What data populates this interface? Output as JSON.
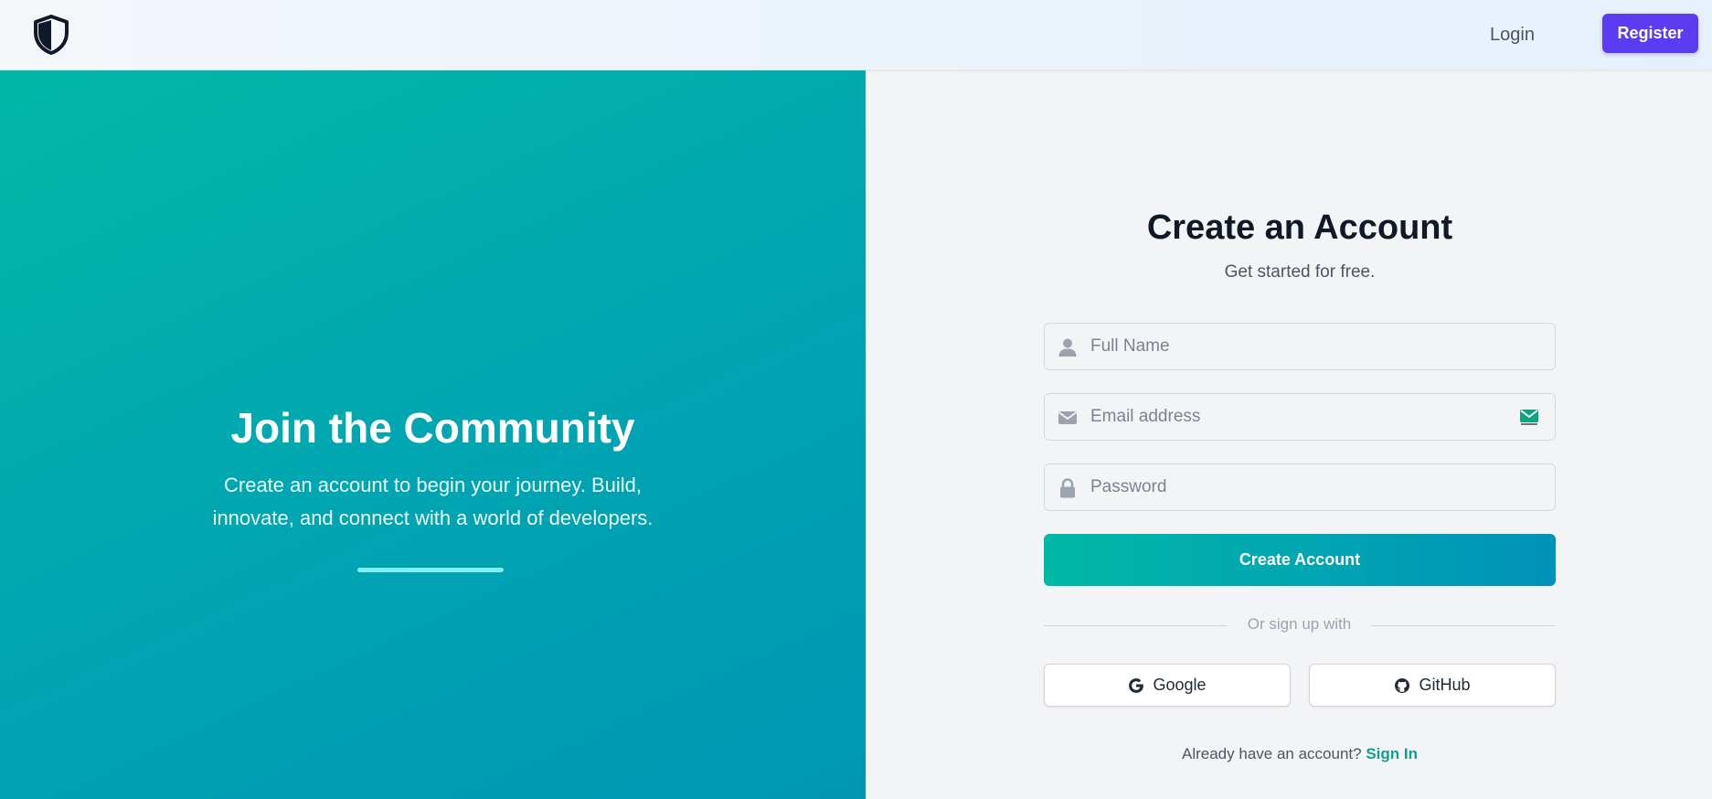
{
  "nav": {
    "login_label": "Login",
    "register_label": "Register"
  },
  "hero": {
    "title": "Join the Community",
    "text": "Create an account to begin your journey. Build, innovate, and connect with a world of developers."
  },
  "form": {
    "title": "Create an Account",
    "subtitle": "Get started for free.",
    "fields": {
      "name_placeholder": "Full Name",
      "email_placeholder": "Email address",
      "password_placeholder": "Password"
    },
    "submit_label": "Create Account",
    "divider_text": "Or sign up with",
    "social": {
      "google_label": "Google",
      "github_label": "GitHub"
    },
    "signin_prompt": "Already have an account?",
    "signin_link": "Sign In"
  },
  "icons": {
    "logo": "shield-icon",
    "name": "user-icon",
    "email": "envelope-icon",
    "email_extension": "password-manager-icon",
    "password": "lock-icon",
    "google": "google-icon",
    "github": "github-icon"
  },
  "colors": {
    "brand_primary": "#5b3cf0",
    "accent_teal": "#00b8a6",
    "accent_blue": "#0092b8",
    "link": "#0f9f8e"
  }
}
